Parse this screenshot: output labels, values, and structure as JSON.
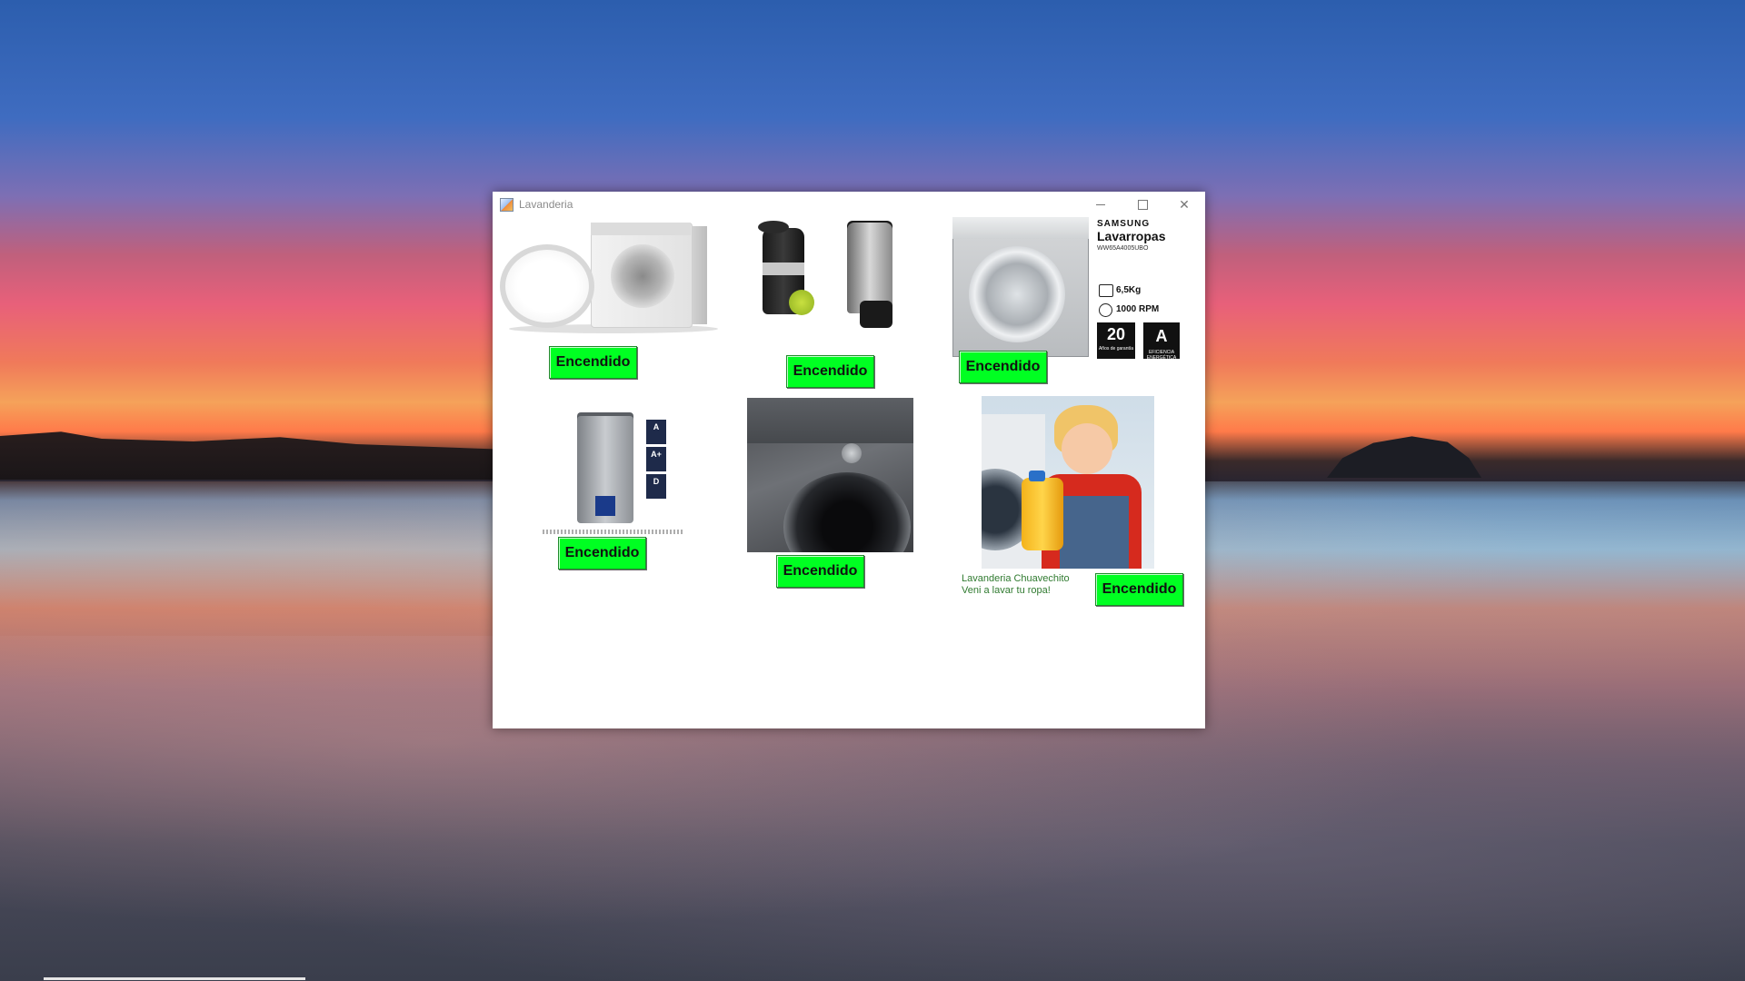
{
  "window": {
    "title": "Lavanderia",
    "controls": {
      "minimize_icon": "minimize-icon",
      "maximize_icon": "maximize-icon",
      "close_icon": "close-icon"
    }
  },
  "machines": [
    {
      "id": "washer-1",
      "type": "front-load washer",
      "button_label": "Encendido",
      "button_color": "#00ff22"
    },
    {
      "id": "spin-dryers",
      "type": "spin dryers",
      "button_label": "Encendido",
      "button_color": "#00ff22"
    },
    {
      "id": "samsung",
      "type": "front-load washer",
      "button_label": "Encendido",
      "button_color": "#00ff22",
      "card": {
        "brand": "SAMSUNG",
        "name": "Lavarropas",
        "model": "WW65A4005UBO",
        "capacity": "6,5Kg",
        "speed": "1000 RPM",
        "warranty_number": "20",
        "warranty_text": "Años de garantía",
        "energy_class": "A",
        "energy_text": "EFICIENCIA ENERGÉTICA"
      }
    },
    {
      "id": "top-load",
      "type": "top-load washer",
      "button_label": "Encendido",
      "button_color": "#00ff22",
      "tags": [
        "A",
        "A+",
        "D"
      ]
    },
    {
      "id": "lg",
      "type": "front-load washer",
      "button_label": "Encendido",
      "button_color": "#00ff22"
    },
    {
      "id": "promo",
      "type": "promo image",
      "button_label": "Encendido",
      "button_color": "#00ff22",
      "caption_line1": "Lavanderia Chuavechito",
      "caption_line2": "Veni a lavar tu ropa!"
    }
  ]
}
